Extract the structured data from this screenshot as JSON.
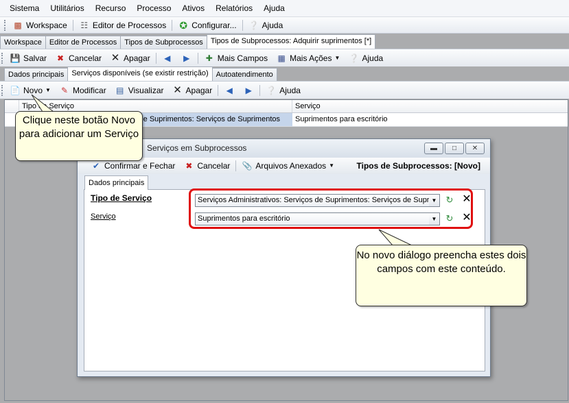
{
  "menu": [
    "Sistema",
    "Utilitários",
    "Recurso",
    "Processo",
    "Ativos",
    "Relatórios",
    "Ajuda"
  ],
  "main_toolbar": {
    "workspace": "Workspace",
    "editor": "Editor de Processos",
    "configurar": "Configurar...",
    "ajuda": "Ajuda"
  },
  "doc_tabs": [
    "Workspace",
    "Editor de Processos",
    "Tipos de Subprocessos",
    "Tipos de Subprocessos: Adquirir suprimentos [*]"
  ],
  "record_toolbar": {
    "salvar": "Salvar",
    "cancelar": "Cancelar",
    "apagar": "Apagar",
    "mais_campos": "Mais Campos",
    "mais_acoes": "Mais Ações",
    "ajuda": "Ajuda"
  },
  "sub_tabs": [
    "Dados principais",
    "Serviços disponíveis (se existir restrição)",
    "Autoatendimento"
  ],
  "grid_toolbar": {
    "novo": "Novo",
    "modificar": "Modificar",
    "visualizar": "Visualizar",
    "apagar": "Apagar",
    "ajuda": "Ajuda"
  },
  "grid": {
    "headers": [
      "Tipo de Serviço",
      "Serviço"
    ],
    "row": {
      "tipo": "Serviços Administrativos: Serviços de Suprimentos: Serviços de Suprimentos",
      "servico": "Suprimentos para escritório"
    }
  },
  "callout1": "Clique neste botão Novo para adicionar um Serviço",
  "dialog": {
    "title": "Serviços em Subprocessos",
    "confirmar": "Confirmar e Fechar",
    "cancelar": "Cancelar",
    "arquivos": "Arquivos Anexados",
    "title_right": "Tipos de Subprocessos: [Novo]",
    "tab": "Dados principais",
    "field1_label": "Tipo de Serviço",
    "field1_value": "Serviços Administrativos: Serviços de Suprimentos: Serviços de Suprimentos",
    "field2_label": "Serviço",
    "field2_value": "Suprimentos para escritório"
  },
  "callout2": "No novo diálogo preencha estes dois campos com este conteúdo."
}
